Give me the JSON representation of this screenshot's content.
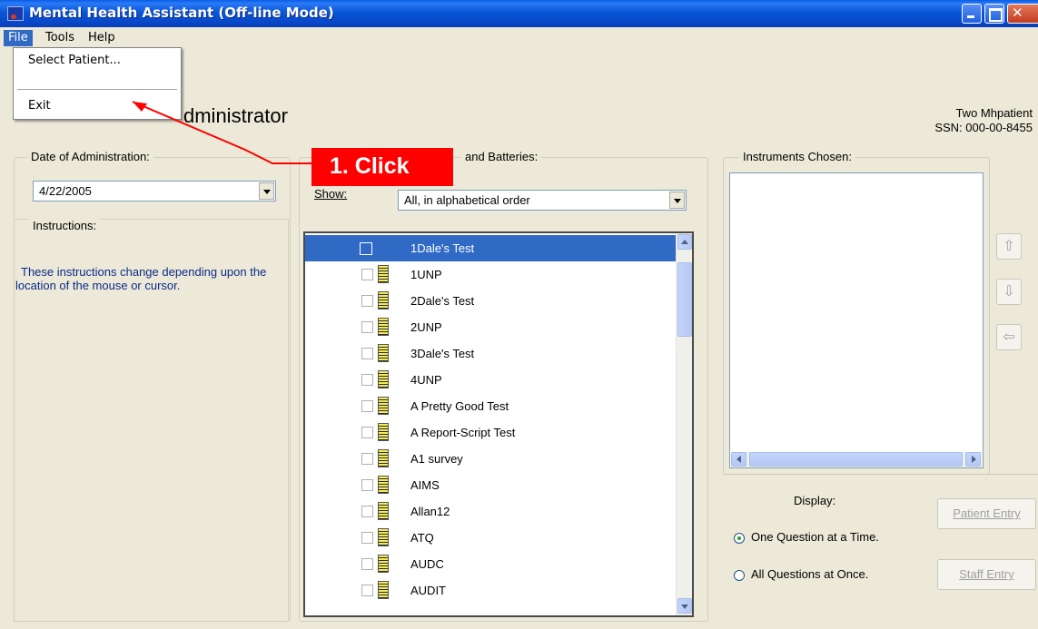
{
  "window": {
    "title": "Mental Health Assistant  (Off-line Mode)"
  },
  "menubar": {
    "items": [
      "File",
      "Tools",
      "Help"
    ]
  },
  "file_menu": {
    "items": [
      "Select Patient...",
      "Exit"
    ]
  },
  "page": {
    "heading": "dministrator",
    "patient_name": "Two Mhpatient",
    "patient_ssn": "SSN: 000-00-8455"
  },
  "date_panel": {
    "legend": "Date of Administration:",
    "value": "4/22/2005"
  },
  "instructions_panel": {
    "legend": "Instructions:",
    "text": "These instructions change depending upon the location of the mouse or cursor."
  },
  "instruments_panel": {
    "legend_partial": "and Batteries:",
    "show_label": "Show:",
    "show_value": "All, in alphabetical order",
    "items": [
      "1Dale's Test",
      "1UNP",
      "2Dale's Test",
      "2UNP",
      "3Dale's Test",
      "4UNP",
      "A Pretty Good Test",
      "A Report-Script Test",
      "A1 survey",
      "AIMS",
      "Allan12",
      "ATQ",
      "AUDC",
      "AUDIT"
    ],
    "selected_index": 0
  },
  "chosen_panel": {
    "legend": "Instruments Chosen:"
  },
  "order_buttons": {
    "up_icon": "arrow-up-icon",
    "down_icon": "arrow-down-icon",
    "remove_icon": "arrow-left-icon"
  },
  "display_panel": {
    "label": "Display:",
    "options": [
      "One Question at a Time.",
      "All Questions at Once."
    ],
    "selected_index": 0,
    "patient_entry": "Patient Entry",
    "staff_entry": "Staff Entry"
  },
  "annotation": {
    "callout": "1. Click",
    "color": "#ff0000"
  },
  "colors": {
    "selection": "#316ac5",
    "titlebar": "#0a56d8",
    "window_bg": "#ece9d8"
  }
}
